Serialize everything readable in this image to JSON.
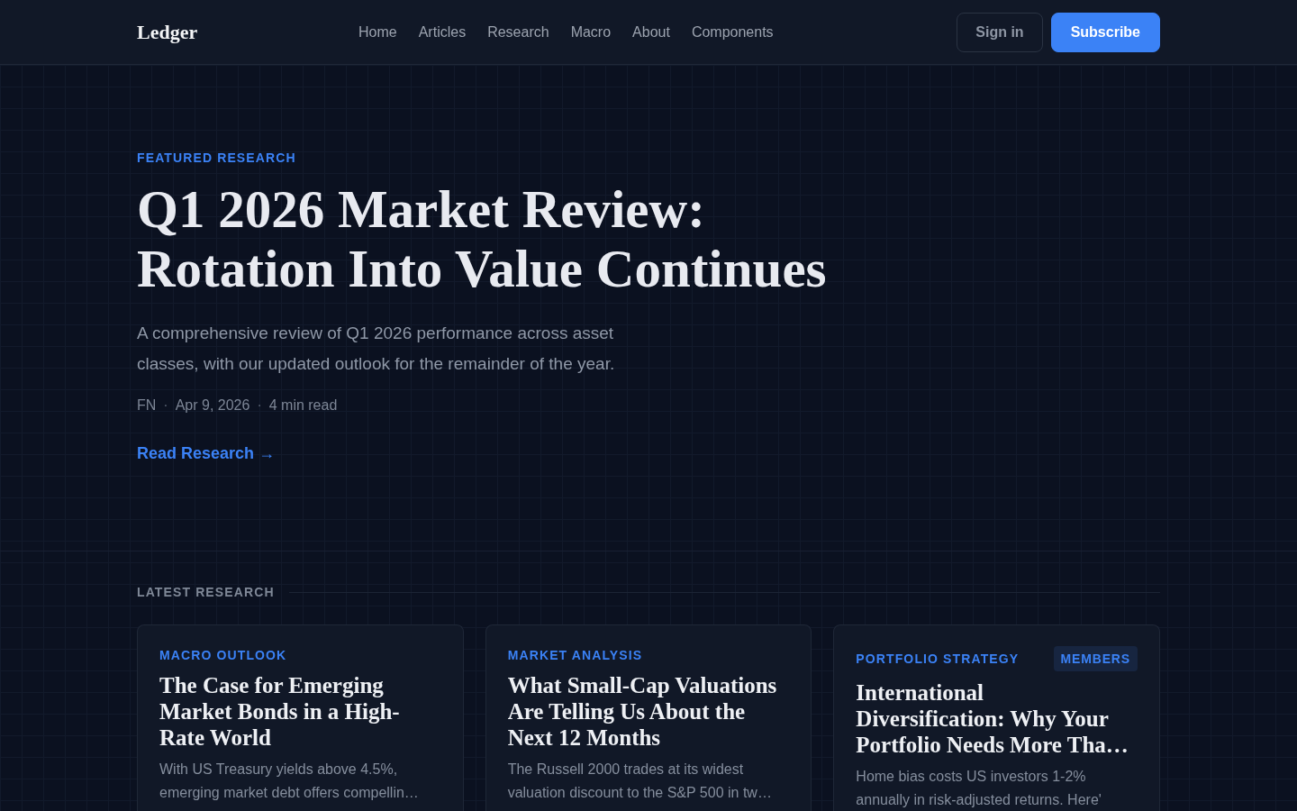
{
  "header": {
    "logo": "Ledger",
    "nav": [
      {
        "label": "Home"
      },
      {
        "label": "Articles"
      },
      {
        "label": "Research"
      },
      {
        "label": "Macro"
      },
      {
        "label": "About"
      },
      {
        "label": "Components"
      }
    ],
    "actions": [
      {
        "label": "Sign in",
        "kind": "outline"
      },
      {
        "label": "Subscribe",
        "kind": "primary"
      }
    ]
  },
  "hero": {
    "eyebrow": "FEATURED RESEARCH",
    "title": "Q1 2026 Market Review: Rotation Into Value Continues",
    "summary": "A comprehensive review of Q1 2026 performance across asset classes, with our updated outlook for the remainder of the year.",
    "meta": [
      {
        "kind": "author",
        "text": "FN"
      },
      {
        "kind": "separator",
        "text": "·"
      },
      {
        "kind": "date",
        "text": "Apr 9, 2026"
      },
      {
        "kind": "separator",
        "text": "·"
      },
      {
        "kind": "read_time",
        "text": "4 min read"
      }
    ],
    "link": "Read Research →"
  },
  "latest": {
    "heading": "LATEST RESEARCH",
    "cards": [
      {
        "category": "MACRO OUTLOOK",
        "title": "The Case for Emerging Market Bonds in a High-Rate World",
        "excerpt": "With US Treasury yields above 4.5%, emerging market debt offers compellin…"
      },
      {
        "category": "MARKET ANALYSIS",
        "title": "What Small-Cap Valuations Are Telling Us About the Next 12 Months",
        "excerpt": "The Russell 2000 trades at its widest valuation discount to the S&P 500 in tw…"
      },
      {
        "category": "PORTFOLIO STRATEGY",
        "badge": "MEMBERS",
        "title": "International Diversification: Why Your Portfolio Needs More Tha…",
        "excerpt": "Home bias costs US investors 1-2% annually in risk-adjusted returns. Here'"
      }
    ]
  }
}
